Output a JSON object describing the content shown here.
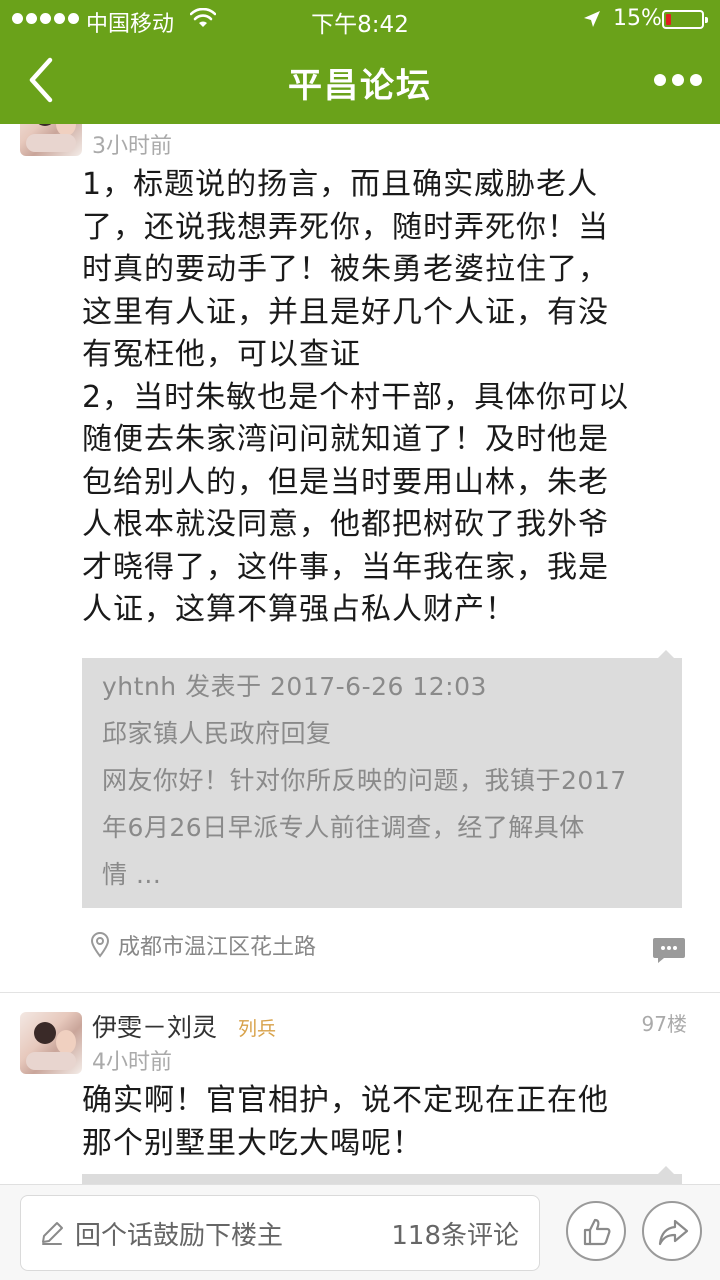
{
  "status_bar": {
    "carrier": "中国移动",
    "time": "下午8:42",
    "battery_percent": "15%",
    "battery_level": 0.15
  },
  "nav": {
    "title": "平昌论坛",
    "back_icon": "back-chevron-icon",
    "more_icon": "more-dots-icon"
  },
  "posts": [
    {
      "time": "3小时前",
      "body": "1，标题说的扬言，而且确实威胁老人\n了，还说我想弄死你，随时弄死你！当\n时真的要动手了！被朱勇老婆拉住了，\n这里有人证，并且是好几个人证，有没\n有冤枉他，可以查证\n2，当时朱敏也是个村干部，具体你可以\n随便去朱家湾问问就知道了！及时他是\n包给别人的，但是当时要用山林，朱老\n人根本就没同意，他都把树砍了我外爷\n才晓得了，这件事，当年我在家，我是\n人证，这算不算强占私人财产！",
      "quote": {
        "line1": "yhtnh 发表于 2017-6-26 12:03",
        "line2": "邱家镇人民政府回复",
        "line3": "网友你好！针对你所反映的问题，我镇于2017",
        "line4": "年6月26日早派专人前往调查，经了解具体",
        "line5": "情 ..."
      },
      "location": "成都市温江区花土路"
    },
    {
      "username": "伊雯－刘灵",
      "rank": "列兵",
      "floor": "97楼",
      "time": "4小时前",
      "body": "确实啊！官官相护，说不定现在正在他\n那个别墅里大吃大喝呢！"
    }
  ],
  "bottom_bar": {
    "reply_placeholder": "回个话鼓励下楼主",
    "comment_count": "118条评论",
    "like_icon": "thumbs-up-icon",
    "share_icon": "share-icon"
  },
  "colors": {
    "brand_green": "#6aa21a",
    "rank_gold": "#d8a24a",
    "quote_bg": "#dcdcdc"
  }
}
